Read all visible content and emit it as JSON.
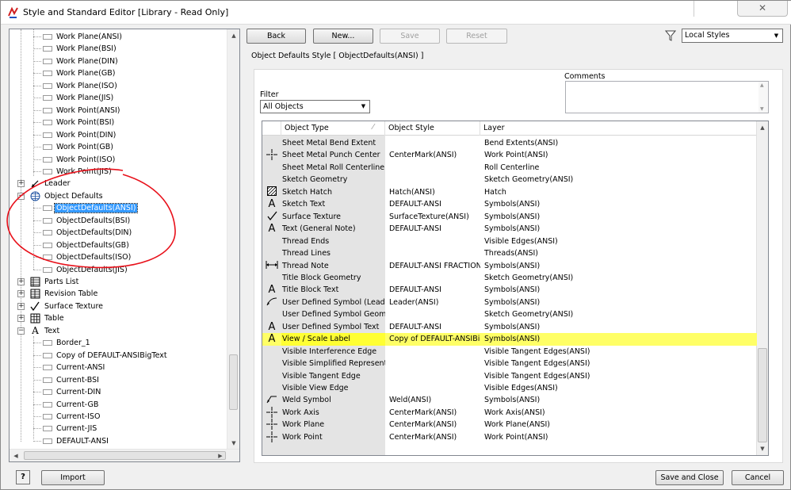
{
  "window": {
    "title": "Style and Standard Editor [Library - Read Only]",
    "close_glyph": "✕"
  },
  "toolbar": {
    "back_label": "Back",
    "new_label": "New...",
    "save_label": "Save",
    "reset_label": "Reset",
    "filter_select_value": "Local Styles"
  },
  "tree": {
    "items": [
      {
        "label": "Work Plane(ANSI)",
        "level": 2
      },
      {
        "label": "Work Plane(BSI)",
        "level": 2
      },
      {
        "label": "Work Plane(DIN)",
        "level": 2
      },
      {
        "label": "Work Plane(GB)",
        "level": 2
      },
      {
        "label": "Work Plane(ISO)",
        "level": 2
      },
      {
        "label": "Work Plane(JIS)",
        "level": 2
      },
      {
        "label": "Work Point(ANSI)",
        "level": 2
      },
      {
        "label": "Work Point(BSI)",
        "level": 2
      },
      {
        "label": "Work Point(DIN)",
        "level": 2
      },
      {
        "label": "Work Point(GB)",
        "level": 2
      },
      {
        "label": "Work Point(ISO)",
        "level": 2
      },
      {
        "label": "Work Point(JIS)",
        "level": 2
      },
      {
        "label": "Leader",
        "level": 1,
        "icon": "leader-icon",
        "expander": "+"
      },
      {
        "label": "Object Defaults",
        "level": 1,
        "icon": "globe-icon",
        "expander": "−"
      },
      {
        "label": "ObjectDefaults(ANSI)",
        "level": 2,
        "selected": true
      },
      {
        "label": "ObjectDefaults(BSI)",
        "level": 2
      },
      {
        "label": "ObjectDefaults(DIN)",
        "level": 2
      },
      {
        "label": "ObjectDefaults(GB)",
        "level": 2
      },
      {
        "label": "ObjectDefaults(ISO)",
        "level": 2
      },
      {
        "label": "ObjectDefaults(JIS)",
        "level": 2
      },
      {
        "label": "Parts List",
        "level": 1,
        "icon": "parts-list-icon",
        "expander": "+"
      },
      {
        "label": "Revision Table",
        "level": 1,
        "icon": "revision-table-icon",
        "expander": "+"
      },
      {
        "label": "Surface Texture",
        "level": 1,
        "icon": "surface-texture-icon",
        "expander": "+"
      },
      {
        "label": "Table",
        "level": 1,
        "icon": "table-icon",
        "expander": "+"
      },
      {
        "label": "Text",
        "level": 1,
        "icon": "text-icon",
        "expander": "−"
      },
      {
        "label": "Border_1",
        "level": 2
      },
      {
        "label": "Copy of DEFAULT-ANSIBigText",
        "level": 2
      },
      {
        "label": "Current-ANSI",
        "level": 2
      },
      {
        "label": "Current-BSI",
        "level": 2
      },
      {
        "label": "Current-DIN",
        "level": 2
      },
      {
        "label": "Current-GB",
        "level": 2
      },
      {
        "label": "Current-ISO",
        "level": 2
      },
      {
        "label": "Current-JIS",
        "level": 2
      },
      {
        "label": "DEFAULT-ANSI",
        "level": 2
      }
    ]
  },
  "panel": {
    "style_header": "Object Defaults Style [ ObjectDefaults(ANSI) ]",
    "filter_label": "Filter",
    "filter_value": "All Objects",
    "comments_label": "Comments"
  },
  "grid": {
    "headers": [
      "Object Type",
      "Object Style",
      "Layer"
    ],
    "rows": [
      {
        "icon": "",
        "type": "Sheet Metal Bend Extent",
        "style": "",
        "layer": "Bend Extents(ANSI)"
      },
      {
        "icon": "crosshair",
        "type": "Sheet Metal Punch Center",
        "style": "CenterMark(ANSI)",
        "layer": "Work Point(ANSI)"
      },
      {
        "icon": "",
        "type": "Sheet Metal Roll Centerline",
        "style": "",
        "layer": "Roll Centerline"
      },
      {
        "icon": "",
        "type": "Sketch Geometry",
        "style": "",
        "layer": "Sketch Geometry(ANSI)"
      },
      {
        "icon": "hatch",
        "type": "Sketch Hatch",
        "style": "Hatch(ANSI)",
        "layer": "Hatch"
      },
      {
        "icon": "A",
        "type": "Sketch Text",
        "style": "DEFAULT-ANSI",
        "layer": "Symbols(ANSI)"
      },
      {
        "icon": "check",
        "type": "Surface Texture",
        "style": "SurfaceTexture(ANSI)",
        "layer": "Symbols(ANSI)"
      },
      {
        "icon": "A",
        "type": "Text (General Note)",
        "style": "DEFAULT-ANSI",
        "layer": "Symbols(ANSI)"
      },
      {
        "icon": "",
        "type": "Thread Ends",
        "style": "",
        "layer": "Visible Edges(ANSI)"
      },
      {
        "icon": "",
        "type": "Thread Lines",
        "style": "",
        "layer": "Threads(ANSI)"
      },
      {
        "icon": "dim",
        "type": "Thread Note",
        "style": "DEFAULT-ANSI FRACTION",
        "layer": "Symbols(ANSI)"
      },
      {
        "icon": "",
        "type": "Title Block Geometry",
        "style": "",
        "layer": "Sketch Geometry(ANSI)"
      },
      {
        "icon": "A",
        "type": "Title Block Text",
        "style": "DEFAULT-ANSI",
        "layer": "Symbols(ANSI)"
      },
      {
        "icon": "leader",
        "type": "User Defined Symbol (Leader On)",
        "style": "Leader(ANSI)",
        "layer": "Symbols(ANSI)"
      },
      {
        "icon": "",
        "type": "User Defined Symbol Geometry",
        "style": "",
        "layer": "Sketch Geometry(ANSI)"
      },
      {
        "icon": "A",
        "type": "User Defined Symbol Text",
        "style": "DEFAULT-ANSI",
        "layer": "Symbols(ANSI)"
      },
      {
        "icon": "A",
        "type": "View / Scale Label",
        "style": "Copy of DEFAULT-ANSIBigText",
        "layer": "Symbols(ANSI)",
        "highlight": true
      },
      {
        "icon": "",
        "type": "Visible Interference Edge",
        "style": "",
        "layer": "Visible Tangent Edges(ANSI)"
      },
      {
        "icon": "",
        "type": "Visible Simplified Representation",
        "style": "",
        "layer": "Visible Tangent Edges(ANSI)"
      },
      {
        "icon": "",
        "type": "Visible Tangent Edge",
        "style": "",
        "layer": "Visible Tangent Edges(ANSI)"
      },
      {
        "icon": "",
        "type": "Visible View Edge",
        "style": "",
        "layer": "Visible Edges(ANSI)"
      },
      {
        "icon": "weld",
        "type": "Weld Symbol",
        "style": "Weld(ANSI)",
        "layer": "Symbols(ANSI)"
      },
      {
        "icon": "crosshair",
        "type": "Work Axis",
        "style": "CenterMark(ANSI)",
        "layer": "Work Axis(ANSI)"
      },
      {
        "icon": "crosshair",
        "type": "Work Plane",
        "style": "CenterMark(ANSI)",
        "layer": "Work Plane(ANSI)"
      },
      {
        "icon": "crosshair",
        "type": "Work Point",
        "style": "CenterMark(ANSI)",
        "layer": "Work Point(ANSI)"
      }
    ]
  },
  "footer": {
    "help_label": "?",
    "import_label": "Import",
    "save_close_label": "Save and Close",
    "cancel_label": "Cancel"
  },
  "colors": {
    "selection": "#3399ff",
    "highlight": "#ffff33",
    "annotation_circle": "#e8101a"
  }
}
